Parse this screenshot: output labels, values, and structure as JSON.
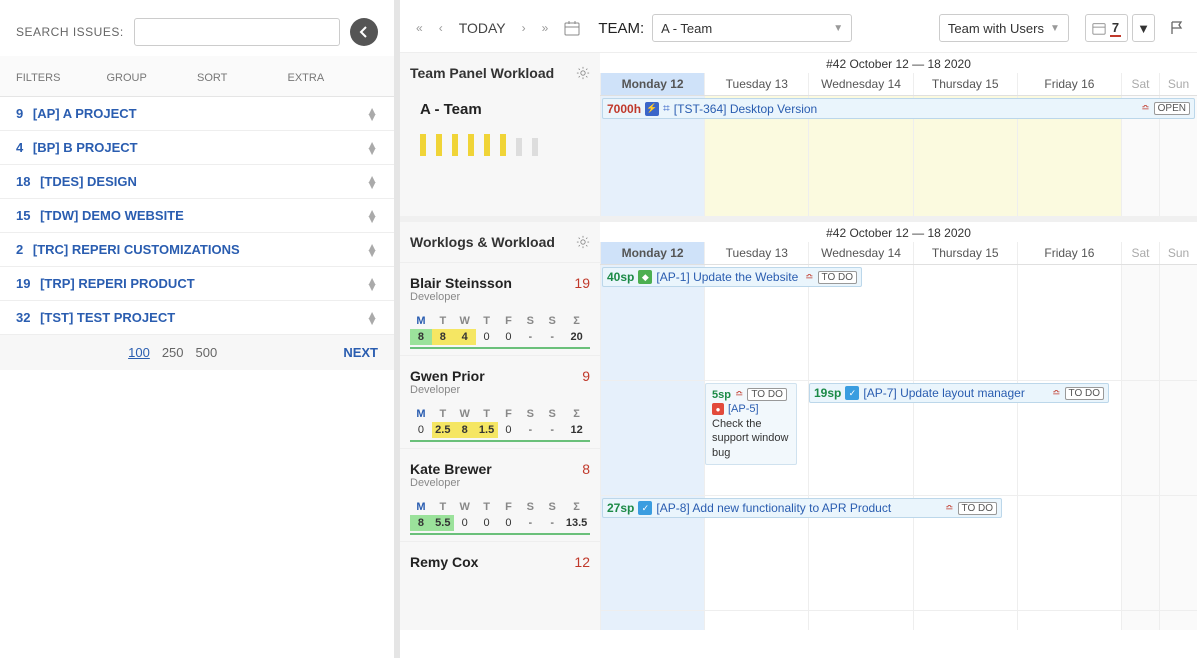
{
  "sidebar": {
    "search_label": "SEARCH ISSUES:",
    "search_placeholder": "",
    "columns": {
      "filters": "FILTERS",
      "group": "GROUP",
      "sort": "SORT",
      "extra": "EXTRA"
    },
    "projects": [
      {
        "count": "9",
        "name": "[AP] A PROJECT"
      },
      {
        "count": "4",
        "name": "[BP] B PROJECT"
      },
      {
        "count": "18",
        "name": "[TDES] DESIGN"
      },
      {
        "count": "15",
        "name": "[TDW] DEMO WEBSITE"
      },
      {
        "count": "2",
        "name": "[TRC] REPERI CUSTOMIZATIONS"
      },
      {
        "count": "19",
        "name": "[TRP] REPERI PRODUCT"
      },
      {
        "count": "32",
        "name": "[TST] TEST PROJECT"
      }
    ],
    "pager": {
      "sizes": [
        "100",
        "250",
        "500"
      ],
      "selected": "100",
      "next": "NEXT"
    }
  },
  "toolbar": {
    "today": "TODAY",
    "team_label": "TEAM:",
    "team_selected": "A - Team",
    "users_selected": "Team with Users",
    "range_number": "7"
  },
  "week_caption": "#42 October 12 — 18 2020",
  "days": [
    "Monday 12",
    "Tuesday 13",
    "Wednesday 14",
    "Thursday 15",
    "Friday 16",
    "Sat",
    "Sun"
  ],
  "team_panel": {
    "title": "Team Panel Workload",
    "team_name": "A - Team",
    "bars": [
      true,
      true,
      true,
      true,
      true,
      true,
      false,
      false
    ],
    "event": {
      "hours": "7000h",
      "key": "[TST-364]",
      "title": "Desktop Version",
      "status": "OPEN"
    }
  },
  "worklogs": {
    "title": "Worklogs & Workload",
    "people": [
      {
        "name": "Blair Steinsson",
        "role": "Developer",
        "total": "19",
        "cols": [
          "M",
          "T",
          "W",
          "T",
          "F",
          "S",
          "S",
          "Σ"
        ],
        "vals": [
          "8",
          "8",
          "4",
          "0",
          "0",
          "-",
          "-",
          "20"
        ],
        "hl": [
          "sel",
          "yel",
          "yel",
          "",
          "",
          "",
          "",
          ""
        ]
      },
      {
        "name": "Gwen Prior",
        "role": "Developer",
        "total": "9",
        "cols": [
          "M",
          "T",
          "W",
          "T",
          "F",
          "S",
          "S",
          "Σ"
        ],
        "vals": [
          "0",
          "2.5",
          "8",
          "1.5",
          "0",
          "-",
          "-",
          "12"
        ],
        "hl": [
          "",
          "yel",
          "yel",
          "yel",
          "",
          "",
          "",
          ""
        ]
      },
      {
        "name": "Kate Brewer",
        "role": "Developer",
        "total": "8",
        "cols": [
          "M",
          "T",
          "W",
          "T",
          "F",
          "S",
          "S",
          "Σ"
        ],
        "vals": [
          "8",
          "5.5",
          "0",
          "0",
          "0",
          "-",
          "-",
          "13.5"
        ],
        "hl": [
          "sel",
          "sel",
          "",
          "",
          "",
          "",
          "",
          ""
        ]
      },
      {
        "name": "Remy Cox",
        "role": "",
        "total": "12",
        "cols": [],
        "vals": [],
        "hl": []
      }
    ],
    "tasks": {
      "blair": {
        "sp": "40sp",
        "key": "[AP-1]",
        "title": "Update the Website",
        "status": "TO DO"
      },
      "gwen1": {
        "sp": "5sp",
        "key": "[AP-5]",
        "title": "Check the support window bug",
        "status": "TO DO"
      },
      "gwen2": {
        "sp": "19sp",
        "key": "[AP-7]",
        "title": "Update layout manager",
        "status": "TO DO"
      },
      "kate": {
        "sp": "27sp",
        "key": "[AP-8]",
        "title": "Add new functionality to APR Product",
        "status": "TO DO"
      }
    }
  }
}
